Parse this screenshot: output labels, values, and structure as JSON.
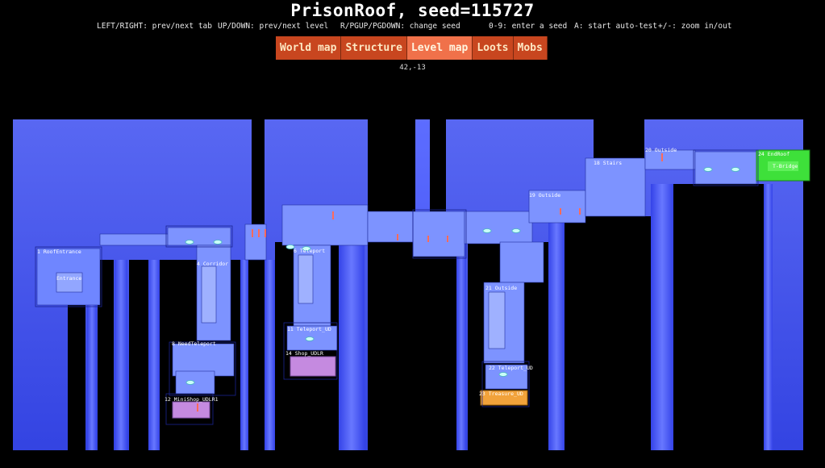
{
  "header": {
    "title": "PrisonRoof, seed=115727"
  },
  "help": [
    "LEFT/RIGHT: prev/next tab",
    "UP/DOWN: prev/next level",
    "R/PGUP/PGDOWN: change seed",
    "0-9: enter a seed",
    "A: start auto-test",
    "+/-: zoom in/out"
  ],
  "tabs": [
    {
      "label": "World map",
      "active": false
    },
    {
      "label": "Structure",
      "active": false
    },
    {
      "label": "Level map",
      "active": true
    },
    {
      "label": "Loots",
      "active": false
    },
    {
      "label": "Mobs",
      "active": false
    }
  ],
  "cursor": {
    "coords": "42,-13"
  },
  "rooms": {
    "r1": "1 RoofEntrance",
    "entrance": "Entrance",
    "r4": "4 Corridor",
    "r6": "6 Teleport",
    "r8": "8 NeedTeleport",
    "r11": "11 Teleport_UD",
    "r12": "12 MiniShop_UDLR1",
    "r14": "14 Shop_UDLR",
    "r18": "18 Stairs",
    "r19": "19 Outside",
    "r20": "20 Outside",
    "r21": "21 Outside",
    "r22": "22 Teleport_UD",
    "r23": "23 Treasure_UD",
    "r24": "24 EndRoof",
    "tbridge": "T-Bridge"
  },
  "colors": {
    "bg": "#000000",
    "region": "#4a5cff",
    "room": "#7d93ff",
    "shop": "#c58ae0",
    "treasure": "#f2a23a",
    "exit": "#3ee03a",
    "tab": "#c8461f",
    "tab_active": "#f0714a"
  }
}
